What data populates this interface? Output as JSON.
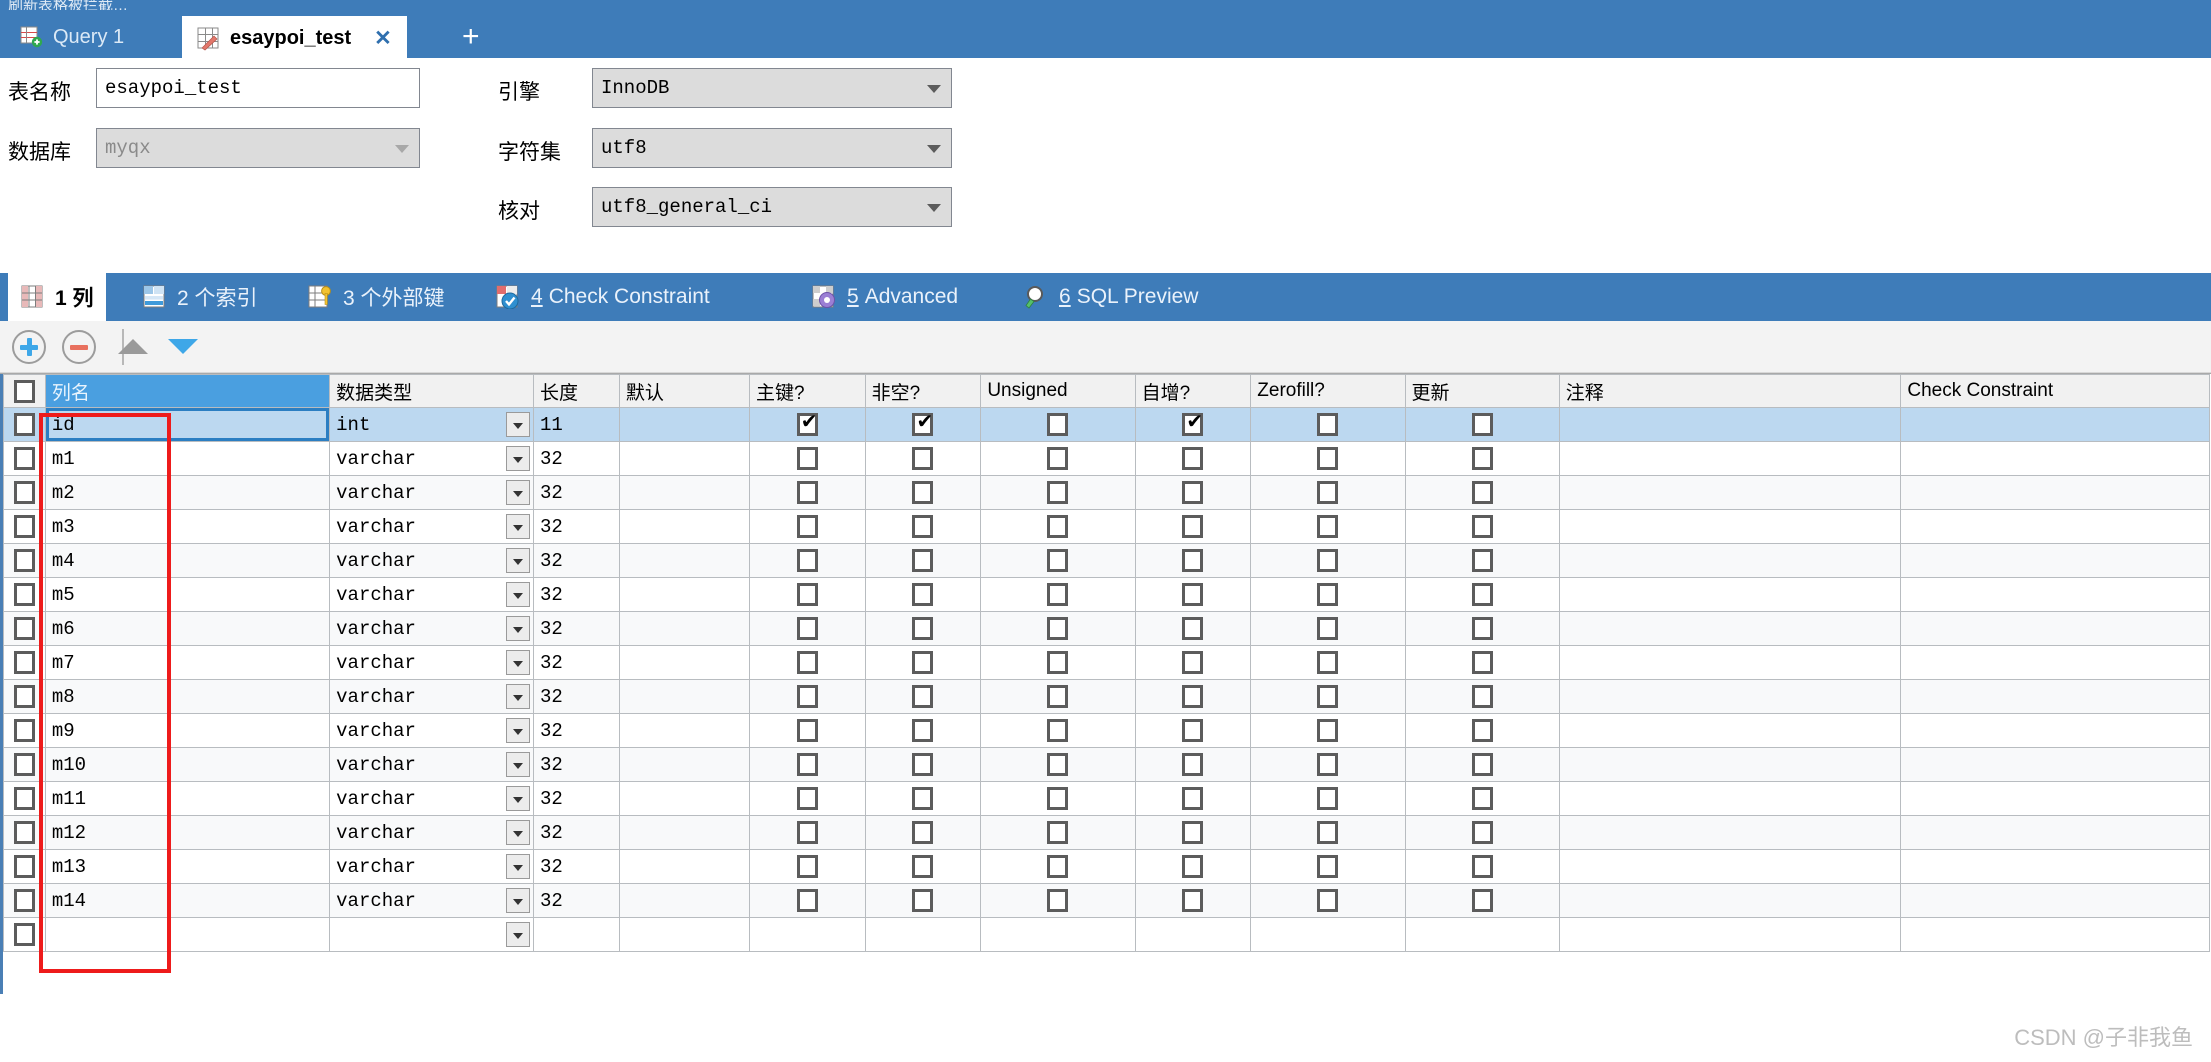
{
  "window": {
    "ghost_title": "刷新表格被拦截…"
  },
  "doc_tabs": [
    {
      "label": "Query 1",
      "icon": "query-grid-icon",
      "active": false,
      "closable": false
    },
    {
      "label": "esaypoi_test",
      "icon": "table-edit-icon",
      "active": true,
      "closable": true,
      "close_glyph": "✕"
    }
  ],
  "add_tab_glyph": "+",
  "form": {
    "table_name_label": "表名称",
    "table_name_value": "esaypoi_test",
    "database_label": "数据库",
    "database_value": "myqx",
    "engine_label": "引擎",
    "engine_value": "InnoDB",
    "charset_label": "字符集",
    "charset_value": "utf8",
    "collation_label": "核对",
    "collation_value": "utf8_general_ci"
  },
  "section_tabs": [
    {
      "num": "1",
      "label": "列",
      "full": "1 列",
      "icon": "columns-grid-icon",
      "active": true
    },
    {
      "num": "2",
      "label": "个索引",
      "full": "2 个索引",
      "icon": "index-grid-icon",
      "active": false
    },
    {
      "num": "3",
      "label": "个外部键",
      "full": "3 个外部键",
      "icon": "foreign-key-icon",
      "active": false
    },
    {
      "num": "4",
      "label": "Check Constraint",
      "full": "4 Check Constraint",
      "icon": "check-constraint-icon",
      "active": false
    },
    {
      "num": "5",
      "label": "Advanced",
      "full": "5 Advanced",
      "icon": "advanced-gear-icon",
      "active": false
    },
    {
      "num": "6",
      "label": "SQL Preview",
      "full": "6 SQL Preview",
      "icon": "magnifier-icon",
      "active": false
    }
  ],
  "toolbar": {
    "add_title": "添加列",
    "remove_title": "删除列",
    "up_title": "上移",
    "down_title": "下移",
    "add_color": "#3ea7e8",
    "remove_color": "#e8705e",
    "up_color": "#9a9a9a",
    "down_color": "#3ea7e8"
  },
  "grid": {
    "headers": [
      "",
      "列名",
      "数据类型",
      "长度",
      "默认",
      "主键?",
      "非空?",
      "Unsigned",
      "自增?",
      "Zerofill?",
      "更新",
      "注释",
      "Check Constraint"
    ],
    "selected_header_index": 1,
    "selected_row_index": 0,
    "rows": [
      {
        "sel": false,
        "name": "id",
        "type": "int",
        "length": "11",
        "default": "",
        "pk": true,
        "notnull": true,
        "unsigned": false,
        "autoinc": true,
        "zerofill": false,
        "update": false,
        "comment": "",
        "check": ""
      },
      {
        "sel": false,
        "name": "m1",
        "type": "varchar",
        "length": "32",
        "default": "",
        "pk": false,
        "notnull": false,
        "unsigned": false,
        "autoinc": false,
        "zerofill": false,
        "update": false,
        "comment": "",
        "check": ""
      },
      {
        "sel": false,
        "name": "m2",
        "type": "varchar",
        "length": "32",
        "default": "",
        "pk": false,
        "notnull": false,
        "unsigned": false,
        "autoinc": false,
        "zerofill": false,
        "update": false,
        "comment": "",
        "check": ""
      },
      {
        "sel": false,
        "name": "m3",
        "type": "varchar",
        "length": "32",
        "default": "",
        "pk": false,
        "notnull": false,
        "unsigned": false,
        "autoinc": false,
        "zerofill": false,
        "update": false,
        "comment": "",
        "check": ""
      },
      {
        "sel": false,
        "name": "m4",
        "type": "varchar",
        "length": "32",
        "default": "",
        "pk": false,
        "notnull": false,
        "unsigned": false,
        "autoinc": false,
        "zerofill": false,
        "update": false,
        "comment": "",
        "check": ""
      },
      {
        "sel": false,
        "name": "m5",
        "type": "varchar",
        "length": "32",
        "default": "",
        "pk": false,
        "notnull": false,
        "unsigned": false,
        "autoinc": false,
        "zerofill": false,
        "update": false,
        "comment": "",
        "check": ""
      },
      {
        "sel": false,
        "name": "m6",
        "type": "varchar",
        "length": "32",
        "default": "",
        "pk": false,
        "notnull": false,
        "unsigned": false,
        "autoinc": false,
        "zerofill": false,
        "update": false,
        "comment": "",
        "check": ""
      },
      {
        "sel": false,
        "name": "m7",
        "type": "varchar",
        "length": "32",
        "default": "",
        "pk": false,
        "notnull": false,
        "unsigned": false,
        "autoinc": false,
        "zerofill": false,
        "update": false,
        "comment": "",
        "check": ""
      },
      {
        "sel": false,
        "name": "m8",
        "type": "varchar",
        "length": "32",
        "default": "",
        "pk": false,
        "notnull": false,
        "unsigned": false,
        "autoinc": false,
        "zerofill": false,
        "update": false,
        "comment": "",
        "check": ""
      },
      {
        "sel": false,
        "name": "m9",
        "type": "varchar",
        "length": "32",
        "default": "",
        "pk": false,
        "notnull": false,
        "unsigned": false,
        "autoinc": false,
        "zerofill": false,
        "update": false,
        "comment": "",
        "check": ""
      },
      {
        "sel": false,
        "name": "m10",
        "type": "varchar",
        "length": "32",
        "default": "",
        "pk": false,
        "notnull": false,
        "unsigned": false,
        "autoinc": false,
        "zerofill": false,
        "update": false,
        "comment": "",
        "check": ""
      },
      {
        "sel": false,
        "name": "m11",
        "type": "varchar",
        "length": "32",
        "default": "",
        "pk": false,
        "notnull": false,
        "unsigned": false,
        "autoinc": false,
        "zerofill": false,
        "update": false,
        "comment": "",
        "check": ""
      },
      {
        "sel": false,
        "name": "m12",
        "type": "varchar",
        "length": "32",
        "default": "",
        "pk": false,
        "notnull": false,
        "unsigned": false,
        "autoinc": false,
        "zerofill": false,
        "update": false,
        "comment": "",
        "check": ""
      },
      {
        "sel": false,
        "name": "m13",
        "type": "varchar",
        "length": "32",
        "default": "",
        "pk": false,
        "notnull": false,
        "unsigned": false,
        "autoinc": false,
        "zerofill": false,
        "update": false,
        "comment": "",
        "check": ""
      },
      {
        "sel": false,
        "name": "m14",
        "type": "varchar",
        "length": "32",
        "default": "",
        "pk": false,
        "notnull": false,
        "unsigned": false,
        "autoinc": false,
        "zerofill": false,
        "update": false,
        "comment": "",
        "check": ""
      },
      {
        "sel": false,
        "name": "",
        "type": "",
        "length": "",
        "default": "",
        "pk": false,
        "notnull": false,
        "unsigned": false,
        "autoinc": false,
        "zerofill": false,
        "update": false,
        "comment": "",
        "check": "",
        "blank": true
      }
    ]
  },
  "annotation": {
    "shape": "red-rectangle",
    "color": "#ee1b1b",
    "targets": "column name cells id..m14"
  },
  "watermark": {
    "text": "CSDN @子非我鱼"
  },
  "colors": {
    "chrome_blue": "#3e7cb9",
    "header_selected": "#4a9fe0",
    "row_selected": "#bcd8f0",
    "annotation_red": "#ee1b1b"
  }
}
